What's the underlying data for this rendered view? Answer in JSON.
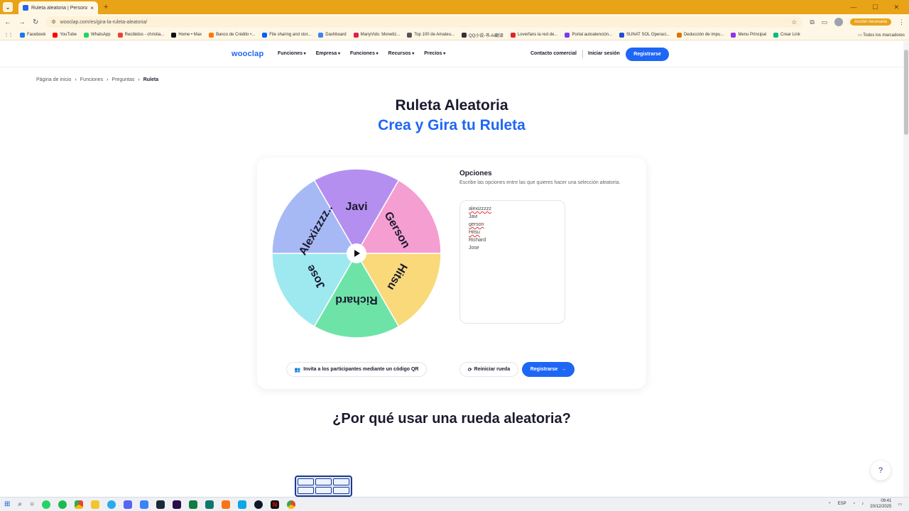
{
  "browser": {
    "tab_title": "Ruleta aleatoria | Personaliza y ...",
    "tab_close": "×",
    "new_tab": "+",
    "url": "wooclap.com/es/gira-la-ruleta-aleatoria/",
    "update_label": "Acción necesaria",
    "bookmarks": [
      {
        "label": "Facebook",
        "color": "#1877f2"
      },
      {
        "label": "YouTube",
        "color": "#ff0000"
      },
      {
        "label": "WhatsApp",
        "color": "#25d366"
      },
      {
        "label": "Recibidos - christia...",
        "color": "#ea4335"
      },
      {
        "label": "Home • Max",
        "color": "#111111"
      },
      {
        "label": "Banco de Crédito •...",
        "color": "#ff7800"
      },
      {
        "label": "File sharing and stor...",
        "color": "#0061fe"
      },
      {
        "label": "Dashboard",
        "color": "#3b82f6"
      },
      {
        "label": "ManyVids: Monetiz...",
        "color": "#e11d48"
      },
      {
        "label": "Top 100 de Amateu...",
        "color": "#555555"
      },
      {
        "label": "QQ小说-书-AI翻译",
        "color": "#333333"
      },
      {
        "label": "Loverfans la red de...",
        "color": "#dc2626"
      },
      {
        "label": "Portal autoatención...",
        "color": "#7c3aed"
      },
      {
        "label": "SUNAT SOL Operaci...",
        "color": "#1d4ed8"
      },
      {
        "label": "Deducción de impu...",
        "color": "#d97706"
      },
      {
        "label": "Menu Principal",
        "color": "#9333ea"
      },
      {
        "label": "Crear Link",
        "color": "#10b981"
      }
    ],
    "all_bookmarks": "Todos los marcadores"
  },
  "nav": {
    "logo": "wooclap",
    "menu": [
      "Funciones",
      "Empresa",
      "Funciones",
      "Recursos",
      "Precios"
    ],
    "contact": "Contacto comercial",
    "login": "Iniciar sesión",
    "register": "Registrarse"
  },
  "breadcrumb": [
    "Página de inicio",
    "Funciones",
    "Preguntas",
    "Ruleta"
  ],
  "hero": {
    "title": "Ruleta Aleatoria",
    "subtitle": "Crea y Gira tu Ruleta"
  },
  "options": {
    "title": "Opciones",
    "description": "Escribe las opciones entre las que quieres hacer una selección aleatoria.",
    "lines": [
      "alexizzzzz",
      "Javi",
      "gerson",
      "Hitsu",
      "Richard",
      "Jose"
    ]
  },
  "wheel": {
    "segments": [
      {
        "label": "Javi",
        "color": "#b48ff0"
      },
      {
        "label": "Gerson",
        "color": "#f59ed1"
      },
      {
        "label": "Hitsu",
        "color": "#f9d97a"
      },
      {
        "label": "Richard",
        "color": "#6ee3a8"
      },
      {
        "label": "Jose",
        "color": "#9ee9f0"
      },
      {
        "label": "Alexizzzz..",
        "color": "#a7b9f5"
      }
    ]
  },
  "buttons": {
    "qr": "Invita a los participantes mediante un código QR",
    "reset": "Reiniciar rueda",
    "register": "Registrarse"
  },
  "section": {
    "why": "¿Por qué usar una rueda aleatoria?"
  },
  "help": "?",
  "taskbar": {
    "lang": "ESP",
    "time": "09:41",
    "date": "20/12/2025"
  }
}
